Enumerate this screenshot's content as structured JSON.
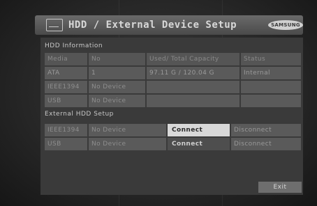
{
  "header": {
    "title": "HDD / External Device Setup",
    "brand": "SAMSUNG",
    "icon": "hdd-icon"
  },
  "hdd_information": {
    "label": "HDD Information",
    "columns": [
      "Media",
      "No",
      "Used/ Total Capacity",
      "Status"
    ],
    "rows": [
      [
        "ATA",
        "1",
        "97.11 G / 120.04 G",
        "Internal"
      ],
      [
        "IEEE1394",
        "No Device",
        "",
        ""
      ],
      [
        "USB",
        "No Device",
        "",
        ""
      ]
    ]
  },
  "external_setup": {
    "label": "External HDD Setup",
    "rows": [
      {
        "media": "IEEE1394",
        "status": "No Device",
        "connect": "Connect",
        "disconnect": "Disconnect"
      },
      {
        "media": "USB",
        "status": "No Device",
        "connect": "Connect",
        "disconnect": "Disconnect"
      }
    ]
  },
  "footer": {
    "exit_label": "Exit"
  },
  "colors": {
    "background": "#262626",
    "panel": "#3a3a3a",
    "cell": "#5a5a5a",
    "active_button": "#d8d8d8"
  }
}
